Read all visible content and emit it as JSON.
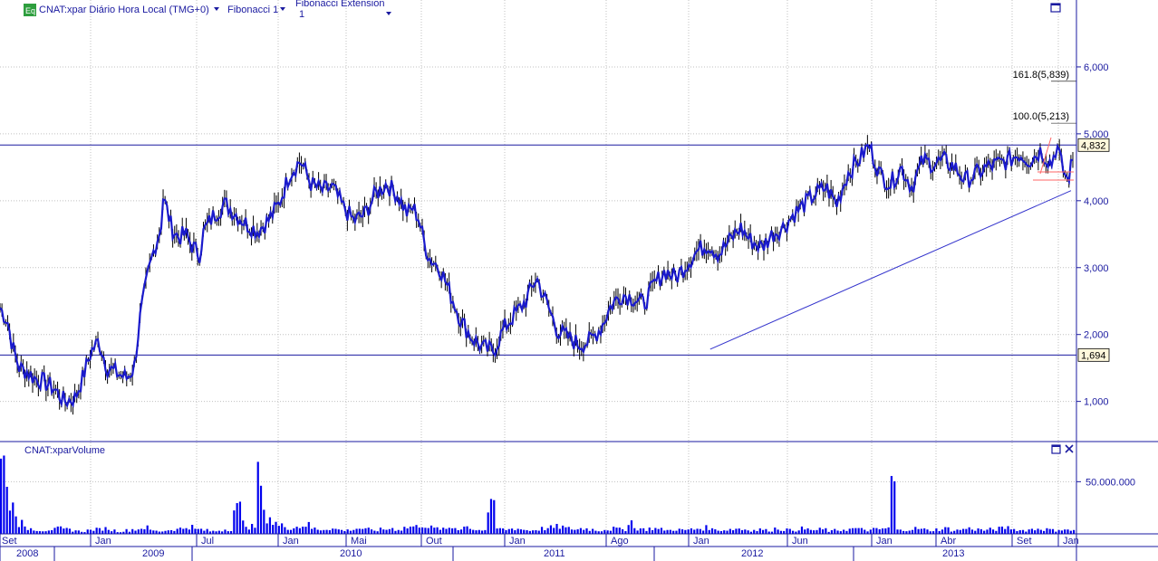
{
  "header": {
    "eq_badge": "Eq",
    "instrument_title": "CNAT:xpar Diário Hora Local (TMG+0)",
    "study_1": "Fibonacci 1",
    "study_2_line1": "Fibonacci Extension",
    "study_2_line2": "1"
  },
  "volume_header": {
    "title": "CNAT:xparVolume"
  },
  "colors": {
    "axis": "#1a1aa0",
    "candle_body": "#1a1acc",
    "candle_outline": "#000000",
    "volume": "#0000ee",
    "grid": "#c0c0c0",
    "label_box": "#fff8dc",
    "fib": "#ff6666",
    "trendline": "#3333cc",
    "badge": "#2e9e3e"
  },
  "icons": [
    "maximize-icon",
    "close-icon"
  ],
  "chart_data": [
    {
      "type": "line",
      "title": "CNAT:xpar Diário Hora Local (TMG+0)",
      "y_axis": {
        "ylim": [
          0.4,
          7.0
        ],
        "ticks": [
          1.0,
          2.0,
          3.0,
          4.0,
          5.0,
          6.0
        ],
        "tick_labels": [
          "1,000",
          "2,000",
          "3,000",
          "4,000",
          "5,000",
          "6,000"
        ],
        "position": "right"
      },
      "x_axis": {
        "month_labels": [
          "Set",
          "Jan",
          "Jul",
          "Jan",
          "Mai",
          "Out",
          "Jan",
          "Ago",
          "Jan",
          "Jun",
          "Jan",
          "Abr",
          "Set",
          "Jan"
        ],
        "year_labels": [
          "2008",
          "2009",
          "2010",
          "2011",
          "2012",
          "2013"
        ]
      },
      "grid": true,
      "horizontal_lines": [
        {
          "value": 4.832,
          "label": "4,832"
        },
        {
          "value": 1.694,
          "label": "1,694"
        }
      ],
      "fibonacci_levels": [
        {
          "label": "161.8(5,839)",
          "value": 5.839
        },
        {
          "label": "100.0(5,213)",
          "value": 5.213
        }
      ],
      "trendline": {
        "from": {
          "x": 0.662,
          "y": 1.78
        },
        "to": {
          "x": 1.0,
          "y": 4.15
        }
      },
      "series": [
        {
          "values_x": [
            0.0,
            0.007,
            0.012,
            0.018,
            0.025,
            0.032,
            0.04,
            0.05,
            0.06,
            0.07,
            0.077,
            0.085,
            0.092,
            0.1,
            0.106,
            0.112,
            0.118,
            0.125,
            0.131,
            0.138,
            0.144,
            0.15,
            0.152,
            0.155,
            0.16,
            0.166,
            0.173,
            0.18,
            0.186,
            0.19,
            0.2,
            0.21,
            0.22,
            0.23,
            0.24,
            0.25,
            0.26,
            0.27,
            0.28,
            0.29,
            0.3,
            0.31,
            0.32,
            0.33,
            0.34,
            0.35,
            0.36,
            0.37,
            0.38,
            0.385,
            0.39,
            0.395,
            0.4,
            0.41,
            0.42,
            0.43,
            0.44,
            0.45,
            0.46,
            0.47,
            0.48,
            0.49,
            0.5,
            0.51,
            0.52,
            0.53,
            0.54,
            0.55,
            0.56,
            0.57,
            0.58,
            0.59,
            0.6,
            0.61,
            0.62,
            0.63,
            0.64,
            0.65,
            0.66,
            0.67,
            0.68,
            0.69,
            0.7,
            0.71,
            0.72,
            0.73,
            0.74,
            0.75,
            0.76,
            0.77,
            0.78,
            0.79,
            0.8,
            0.81,
            0.82,
            0.83,
            0.84,
            0.85,
            0.86,
            0.87,
            0.88,
            0.89,
            0.9,
            0.91,
            0.92,
            0.93,
            0.94,
            0.95,
            0.96,
            0.97,
            0.98,
            0.985,
            0.99,
            0.995,
            1.0
          ],
          "values_y": [
            2.4,
            2.2,
            1.8,
            1.5,
            1.45,
            1.35,
            1.3,
            1.2,
            1.0,
            1.05,
            1.35,
            1.75,
            1.9,
            1.5,
            1.45,
            1.4,
            1.35,
            1.5,
            2.3,
            2.9,
            3.3,
            3.6,
            4.05,
            3.9,
            3.6,
            3.45,
            3.5,
            3.3,
            3.2,
            3.55,
            3.8,
            3.95,
            3.8,
            3.65,
            3.55,
            3.7,
            3.95,
            4.4,
            4.6,
            4.25,
            4.15,
            4.2,
            3.9,
            3.7,
            3.8,
            4.1,
            4.25,
            4.1,
            3.8,
            3.9,
            3.75,
            3.4,
            3.15,
            3.0,
            2.6,
            2.2,
            1.95,
            1.8,
            1.75,
            2.1,
            2.3,
            2.5,
            2.85,
            2.45,
            2.05,
            1.95,
            1.85,
            1.9,
            2.1,
            2.45,
            2.6,
            2.55,
            2.45,
            2.75,
            2.95,
            2.85,
            3.05,
            3.25,
            3.35,
            3.2,
            3.4,
            3.6,
            3.4,
            3.3,
            3.5,
            3.6,
            3.8,
            3.95,
            4.1,
            4.2,
            3.95,
            4.4,
            4.6,
            4.83,
            4.4,
            4.25,
            4.5,
            4.2,
            4.6,
            4.55,
            4.6,
            4.5,
            4.3,
            4.4,
            4.5,
            4.55,
            4.6,
            4.7,
            4.6,
            4.75,
            4.55,
            4.83,
            4.5,
            4.3,
            4.6
          ],
          "x_segments_years": [
            "2008",
            "2009",
            "2010",
            "2011",
            "2012",
            "2013"
          ]
        }
      ]
    },
    {
      "type": "bar",
      "title": "CNAT:xparVolume",
      "y_axis": {
        "ticks": [
          50000000
        ],
        "tick_labels": [
          "50.000.000"
        ],
        "ylim": [
          0,
          85000000
        ]
      },
      "values_note": "daily volume bars",
      "values": [
        78,
        30,
        12,
        6,
        5,
        4,
        5,
        6,
        5,
        4,
        3,
        4,
        5,
        6,
        4,
        3,
        4,
        5,
        7,
        4,
        3,
        4,
        5,
        6,
        8,
        5,
        4,
        3,
        4,
        5,
        28,
        12,
        8,
        60,
        20,
        12,
        9,
        7,
        8,
        10,
        6,
        5,
        6,
        5,
        4,
        5,
        6,
        5,
        4,
        5,
        6,
        5,
        7,
        8,
        10,
        7,
        6,
        5,
        7,
        6,
        8,
        5,
        4,
        28,
        6,
        5,
        6,
        5,
        4,
        5,
        6,
        7,
        8,
        6,
        5,
        6,
        5,
        4,
        5,
        6,
        5,
        14,
        6,
        5,
        6,
        5,
        4,
        5,
        4,
        5,
        6,
        7,
        5,
        4,
        5,
        6,
        5,
        4,
        5,
        4,
        6,
        5,
        4,
        6,
        5,
        4,
        5,
        3,
        4,
        5,
        6,
        5,
        4,
        5,
        6,
        58,
        4,
        5,
        6,
        5,
        4,
        5,
        6,
        4,
        5,
        6,
        5,
        4,
        5,
        6,
        7,
        5,
        4,
        5,
        6,
        5,
        4,
        5,
        4
      ]
    }
  ]
}
